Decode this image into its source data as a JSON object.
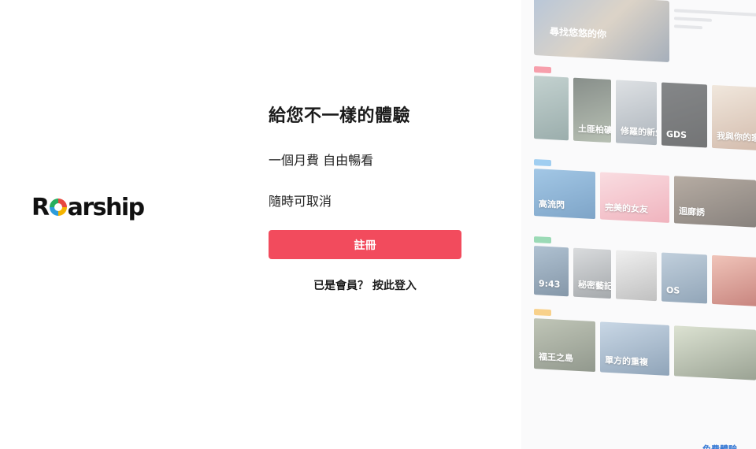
{
  "brand": {
    "name_pre": "R",
    "name_post": "arship"
  },
  "hero": {
    "headline": "給您不一樣的體驗",
    "line1": "一個月費 自由暢看",
    "line2": "隨時可取消"
  },
  "actions": {
    "register_label": "註冊",
    "login_label": "已是會員？ 按此登入",
    "register_color": "#f24b5d"
  },
  "collage": {
    "feature_title": "尋找悠悠的你",
    "sections": [
      {
        "tag_color": "#f2647a",
        "items": [
          {
            "text": "",
            "gradient": "linear-gradient(160deg,#9fb6b3,#5e7c7a)"
          },
          {
            "text": "土匪柏礦團",
            "gradient": "linear-gradient(160deg,#3f4a43,#8c9a86)"
          },
          {
            "text": "修羅的新生",
            "gradient": "linear-gradient(160deg,#c9ced3,#7c8894)"
          },
          {
            "text": "GDS",
            "gradient": "linear-gradient(160deg,#3a3d40,#1e2022)"
          },
          {
            "text": "我與你的家",
            "gradient": "linear-gradient(160deg,#e8d9c8,#b8927a)"
          }
        ]
      },
      {
        "tag_color": "#67b1e8",
        "items": [
          {
            "text": "高流閃",
            "gradient": "linear-gradient(160deg,#6aa5d6,#2f6da6)"
          },
          {
            "text": "完美的女友",
            "gradient": "linear-gradient(160deg,#f6c8cf,#e78596)"
          },
          {
            "text": "迴廊誘",
            "gradient": "linear-gradient(160deg,#8a7a6b,#3f352e)"
          }
        ]
      },
      {
        "tag_color": "#5ec38a",
        "items": [
          {
            "text": "9:43",
            "gradient": "linear-gradient(160deg,#7f9cb6,#3b5874)"
          },
          {
            "text": "秘密藝記",
            "gradient": "linear-gradient(160deg,#c3c6c9,#6e7479)"
          },
          {
            "text": "",
            "gradient": "linear-gradient(160deg,#e6e6e6,#9a9a9a)"
          },
          {
            "text": "OS",
            "gradient": "linear-gradient(160deg,#9bb2c7,#4f6f8d)"
          },
          {
            "text": "",
            "gradient": "linear-gradient(160deg,#e7a08f,#a5382e)"
          }
        ]
      },
      {
        "tag_color": "#f4b545",
        "items": [
          {
            "text": "福王之島",
            "gradient": "linear-gradient(160deg,#9aa38c,#4f5a48)"
          },
          {
            "text": "單方的重複",
            "gradient": "linear-gradient(160deg,#a8bfd6,#4c6d8e)"
          },
          {
            "text": "",
            "gradient": "linear-gradient(160deg,#c7d1b7,#5d6a52)"
          }
        ]
      }
    ]
  },
  "corner_link": "免費體驗"
}
